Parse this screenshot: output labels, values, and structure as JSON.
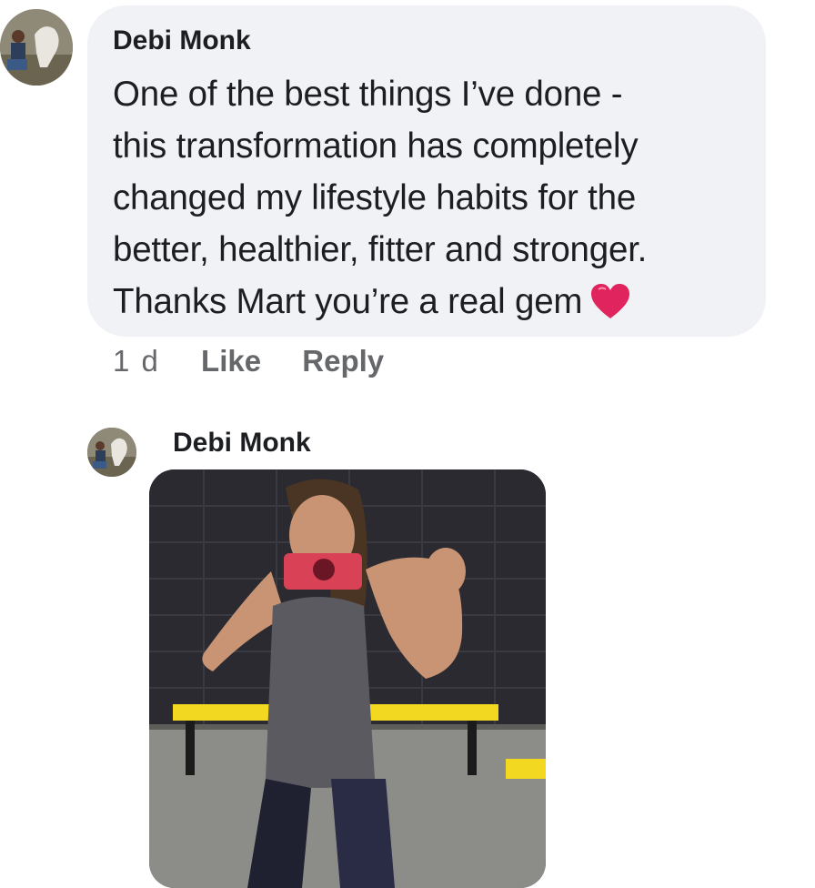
{
  "comment": {
    "author": "Debi Monk",
    "lines": [
      "One of the best things I’ve done -",
      "this transformation has completely",
      "changed my lifestyle habits for the",
      "better, healthier, fitter and stronger.",
      "Thanks Mart you’re a real gem"
    ],
    "emoji": "heart-icon",
    "time": "1 d",
    "like_label": "Like",
    "reply_label": "Reply"
  },
  "reply": {
    "author": "Debi Monk",
    "attachment": "photo"
  },
  "colors": {
    "bubble_bg": "#f0f2f5",
    "text": "#1c1e21",
    "meta": "#65676b",
    "heart": "#e0245e"
  }
}
